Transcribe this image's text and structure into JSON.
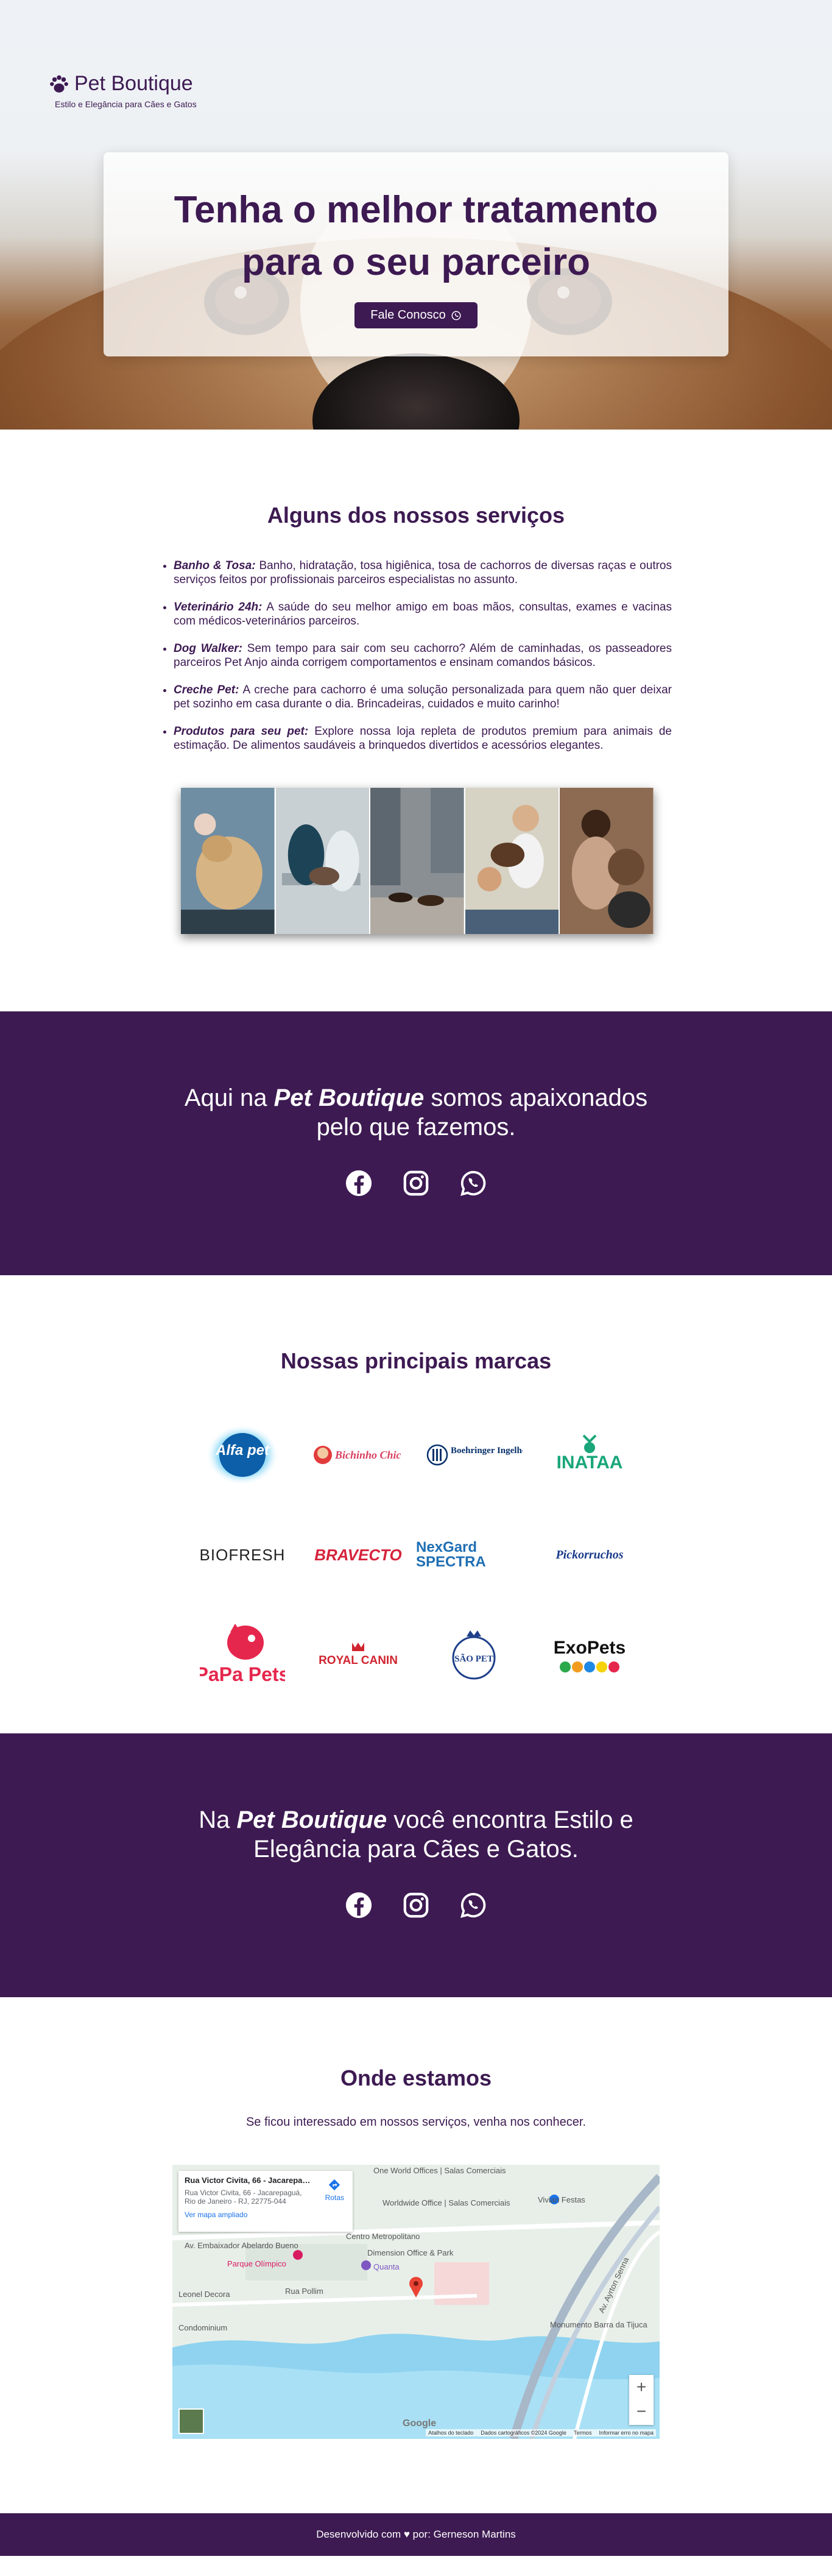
{
  "brand": {
    "title": "Pet Boutique",
    "subtitle": "Estilo e Elegância para Cães e Gatos"
  },
  "hero": {
    "title_line1": "Tenha o melhor tratamento",
    "title_line2": "para o seu parceiro",
    "button": "Fale Conosco"
  },
  "services": {
    "title": "Alguns dos nossos serviços",
    "items": [
      {
        "name": "Banho & Tosa:",
        "text": " Banho, hidratação, tosa higiênica, tosa de cachorros de diversas raças e outros serviços feitos por profissionais parceiros especialistas no assunto."
      },
      {
        "name": "Veterinário 24h:",
        "text": " A saúde do seu melhor amigo em boas mãos, consultas, exames e vacinas com médicos-veterinários parceiros."
      },
      {
        "name": "Dog Walker:",
        "text": " Sem tempo para sair com seu cachorro? Além de caminhadas, os passeadores parceiros Pet Anjo ainda corrigem comportamentos e ensinam comandos básicos."
      },
      {
        "name": "Creche Pet:",
        "text": " A creche para cachorro é uma solução personalizada para quem não quer deixar pet sozinho em casa durante o dia. Brincadeiras, cuidados e muito carinho!"
      },
      {
        "name": "Produtos para seu pet:",
        "text": " Explore nossa loja repleta de produtos premium para animais de estimação. De alimentos saudáveis a brinquedos divertidos e acessórios elegantes."
      }
    ]
  },
  "band1": {
    "pre": "Aqui na ",
    "brand": "Pet Boutique",
    "post": " somos apaixonados",
    "line2": "pelo que fazemos."
  },
  "brands": {
    "title": "Nossas principais marcas",
    "logos": [
      "Alfa pet",
      "Bichinho Chic",
      "Boehringer Ingelheim",
      "INATAA",
      "BIOFRESH",
      "BRAVECTO",
      "NexGard SPECTRA",
      "Pickorruchos",
      "PaPa Pets",
      "ROYAL CANIN",
      "SÃO PET",
      "ExoPets"
    ]
  },
  "band2": {
    "pre": "Na ",
    "brand": "Pet Boutique",
    "post": " você encontra Estilo e",
    "line2": "Elegância para Cães e Gatos."
  },
  "location": {
    "title": "Onde estamos",
    "subtitle": "Se ficou interessado em nossos serviços, venha nos conhecer.",
    "map": {
      "place_title": "Rua Victor Civita, 66 - Jacarepaguá",
      "place_address": "Rua Victor Civita, 66 - Jacarepaguá, Rio de Janeiro - RJ, 22775-044",
      "enlarge": "Ver mapa ampliado",
      "routes": "Rotas",
      "labels": [
        "Vivian Festas",
        "Centro Metropolitano",
        "Worldwide Office | Salas Comerciais",
        "One World Offices | Salas Comerciais",
        "Quanta",
        "Dimension Office & Park",
        "Rua Pollim",
        "Parque Olímpico",
        "Leonel Decora",
        "Condominium",
        "Av. Ayrton Senna",
        "Av. Embaixador Abelardo Bueno",
        "Monumento Barra da Tijuca"
      ],
      "footer": [
        "Atalhos do teclado",
        "Dados cartográficos ©2024 Google",
        "Termos",
        "Informar erro no mapa"
      ],
      "google": "Google"
    }
  },
  "footer": {
    "pre": "Desenvolvido com ",
    "heart": "♥",
    "post": " por: Gerneson Martins"
  }
}
